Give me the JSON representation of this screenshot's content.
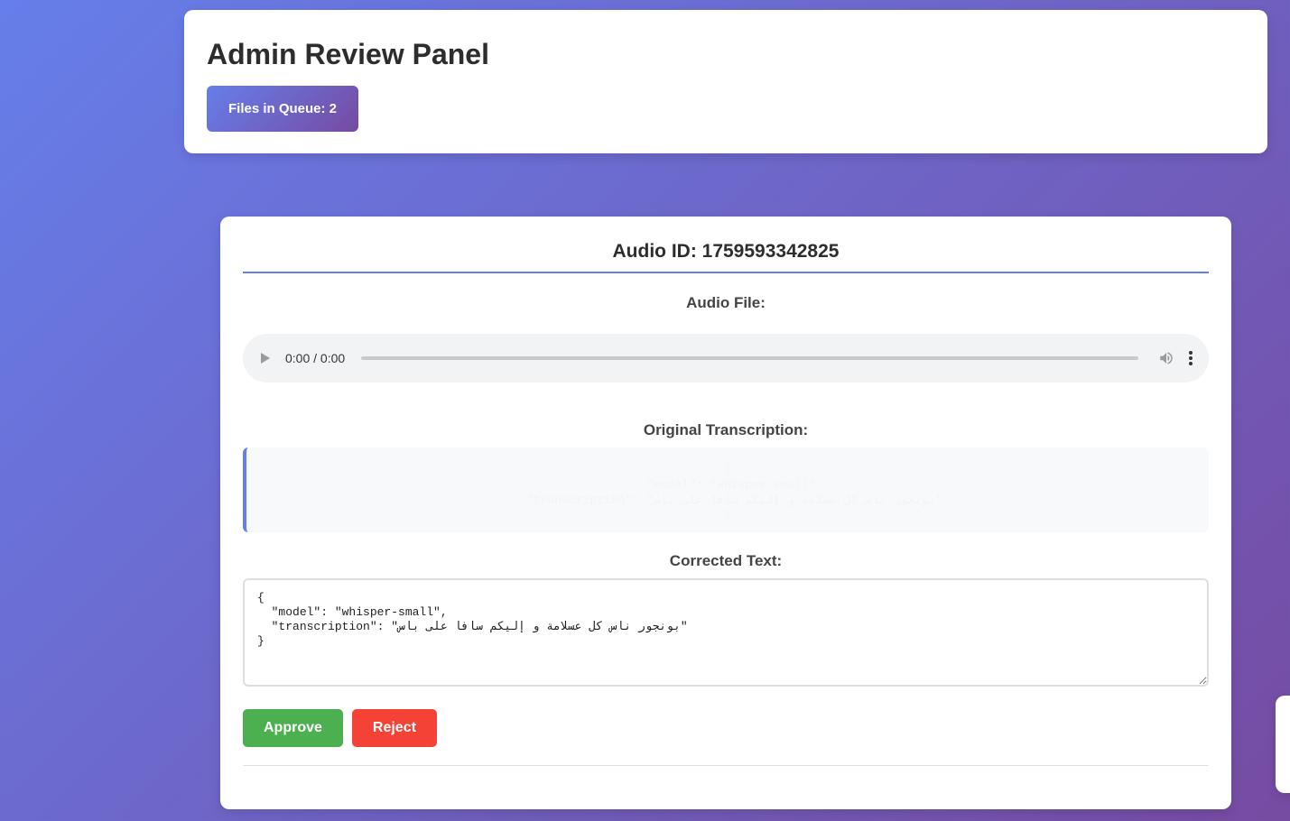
{
  "header": {
    "title": "Admin Review Panel",
    "queue_badge": "Files in Queue: 2"
  },
  "review": {
    "audio_id": "Audio ID: 1759593342825",
    "audio_label": "Audio File:",
    "player": {
      "time": "0:00 / 0:00",
      "progress": 0
    },
    "original_label": "Original Transcription:",
    "original_text": "{\n  \"model\": \"whisper-small\",\n  \"transcription\": \"بونجور ناس كل عسلامة و إليكم سافا على باس\"\n}",
    "corrected_label": "Corrected Text:",
    "corrected_text": "{\n  \"model\": \"whisper-small\",\n  \"transcription\": \"بونجور ناس كل عسلامة و إليكم سافا على باس\"\n}",
    "approve_label": "Approve",
    "reject_label": "Reject"
  },
  "colors": {
    "bg_gradient_start": "#667eea",
    "bg_gradient_end": "#764ba2",
    "approve": "#4caf50",
    "reject": "#f44336"
  },
  "icons": {
    "play": "play-icon",
    "volume": "volume-icon",
    "menu": "more-vertical-icon"
  }
}
